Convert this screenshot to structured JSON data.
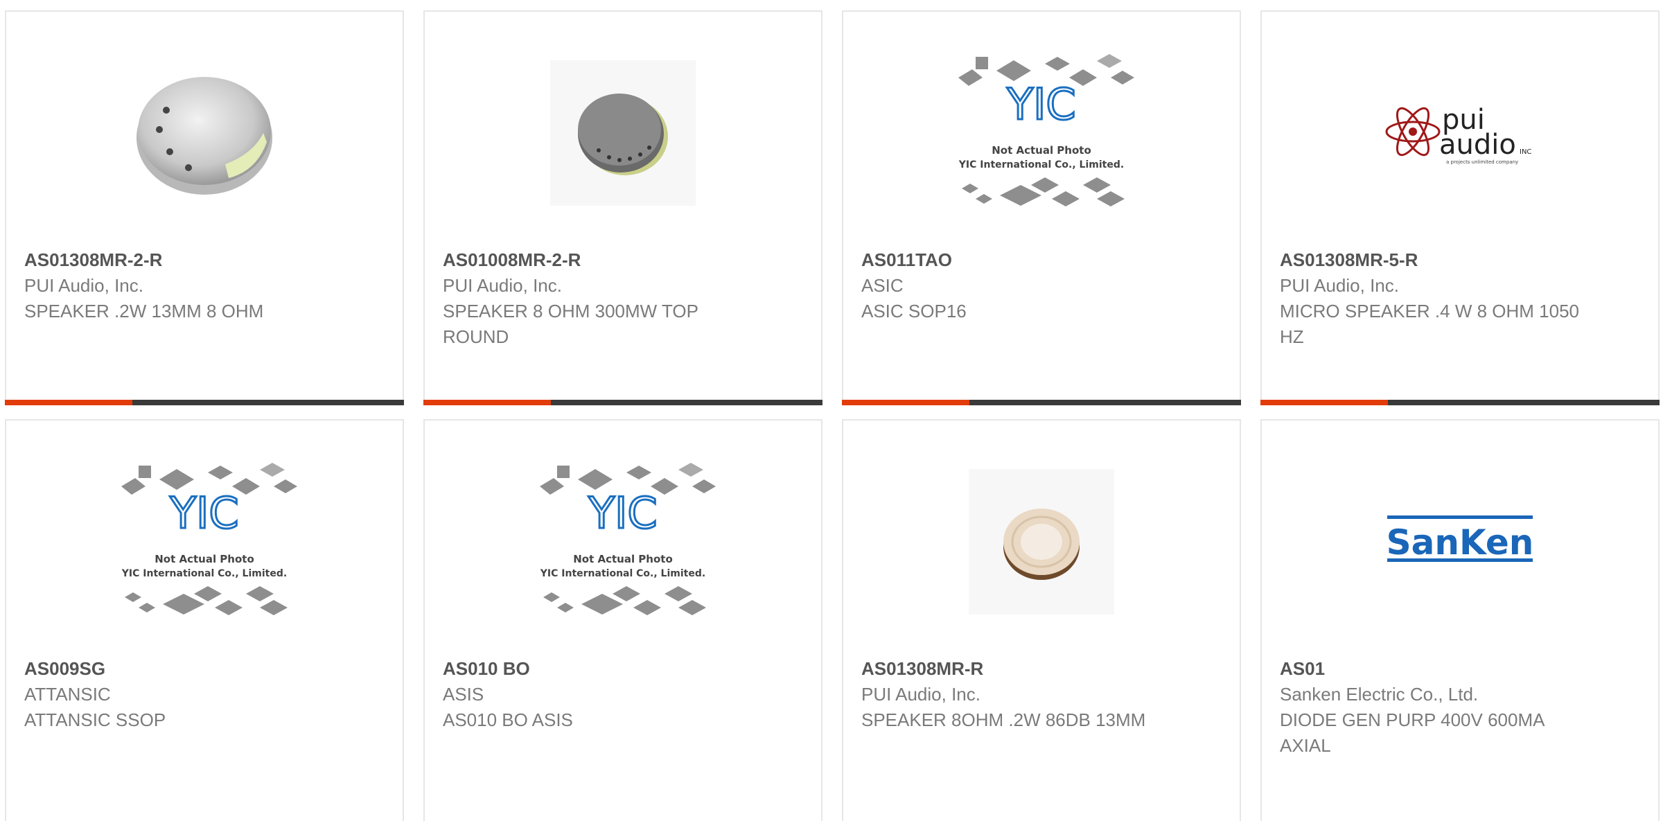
{
  "products": [
    {
      "part": "AS01308MR-2-R",
      "manufacturer": "PUI Audio, Inc.",
      "description": "SPEAKER .2W 13MM 8 OHM",
      "image": "speaker-photo"
    },
    {
      "part": "AS01008MR-2-R",
      "manufacturer": "PUI Audio, Inc.",
      "description": "SPEAKER 8 OHM 300MW TOP ROUND",
      "image": "speaker-dark-photo"
    },
    {
      "part": "AS011TAO",
      "manufacturer": "ASIC",
      "description": "ASIC SOP16",
      "image": "yic-placeholder"
    },
    {
      "part": "AS01308MR-5-R",
      "manufacturer": "PUI Audio, Inc.",
      "description": "MICRO SPEAKER .4 W 8 OHM 1050 HZ",
      "image": "pui-audio-logo"
    },
    {
      "part": "AS009SG",
      "manufacturer": "ATTANSIC",
      "description": "ATTANSIC SSOP",
      "image": "yic-placeholder"
    },
    {
      "part": "AS010 BO",
      "manufacturer": "ASIS",
      "description": "AS010 BO ASIS",
      "image": "yic-placeholder"
    },
    {
      "part": "AS01308MR-R",
      "manufacturer": "PUI Audio, Inc.",
      "description": "SPEAKER 8OHM .2W 86DB 13MM",
      "image": "speaker-ring-photo"
    },
    {
      "part": "AS01",
      "manufacturer": "Sanken Electric Co., Ltd.",
      "description": "DIODE GEN PURP 400V 600MA AXIAL",
      "image": "sanken-logo"
    }
  ],
  "placeholder": {
    "line1": "Not Actual Photo",
    "line2": "YIC International Co., Limited.",
    "logo": "YIC"
  },
  "logos": {
    "pui_main": "pui",
    "pui_sub": "audio",
    "pui_inc": "INC",
    "pui_tagline": "a projects unlimited company",
    "sanken": "SanKen"
  },
  "colors": {
    "accent": "#e23c0b",
    "bar": "#3a3a3a",
    "yic_blue": "#1a6fc0",
    "sanken_blue": "#1a66b8",
    "pui_red": "#a01818"
  }
}
